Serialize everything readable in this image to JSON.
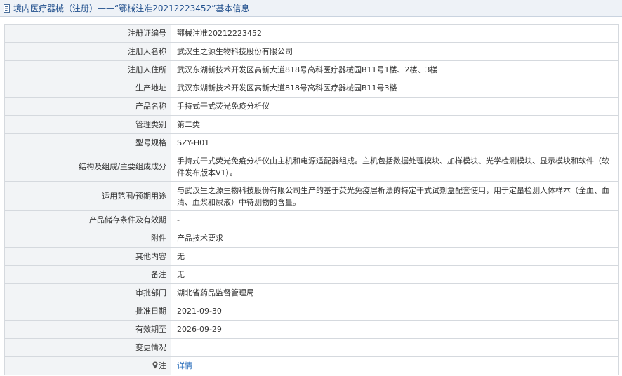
{
  "header": {
    "title": "境内医疗器械（注册）——“鄂械注准20212223452”基本信息"
  },
  "rows": [
    {
      "label": "注册证编号",
      "value": "鄂械注准20212223452"
    },
    {
      "label": "注册人名称",
      "value": "武汉生之源生物科技股份有限公司"
    },
    {
      "label": "注册人住所",
      "value": "武汉东湖新技术开发区高新大道818号高科医疗器械园B11号1楼、2楼、3楼"
    },
    {
      "label": "生产地址",
      "value": "武汉东湖新技术开发区高新大道818号高科医疗器械园B11号3楼"
    },
    {
      "label": "产品名称",
      "value": "手持式干式荧光免疫分析仪"
    },
    {
      "label": "管理类别",
      "value": "第二类"
    },
    {
      "label": "型号规格",
      "value": "SZY-H01"
    },
    {
      "label": "结构及组成/主要组成成分",
      "value": "手持式干式荧光免疫分析仪由主机和电源适配器组成。主机包括数据处理模块、加样模块、光学检测模块、显示模块和软件（软件发布版本V1）。"
    },
    {
      "label": "适用范围/预期用途",
      "value": "与武汉生之源生物科技股份有限公司生产的基于荧光免疫层析法的特定干式试剂盒配套使用，用于定量检测人体样本（全血、血清、血浆和尿液）中待测物的含量。"
    },
    {
      "label": "产品储存条件及有效期",
      "value": "-"
    },
    {
      "label": "附件",
      "value": "产品技术要求"
    },
    {
      "label": "其他内容",
      "value": "无"
    },
    {
      "label": "备注",
      "value": "无"
    },
    {
      "label": "审批部门",
      "value": "湖北省药品监督管理局"
    },
    {
      "label": "批准日期",
      "value": "2021-09-30"
    },
    {
      "label": "有效期至",
      "value": "2026-09-29"
    },
    {
      "label": "变更情况",
      "value": ""
    }
  ],
  "note_row": {
    "label": "注",
    "icon": "pin-icon",
    "link_text": "详情"
  },
  "colors": {
    "header_bg": "#eef2f7",
    "header_text": "#1f4e8c",
    "label_bg": "#f2f4f6",
    "border": "#d5d9de",
    "link": "#2a6ebb"
  }
}
